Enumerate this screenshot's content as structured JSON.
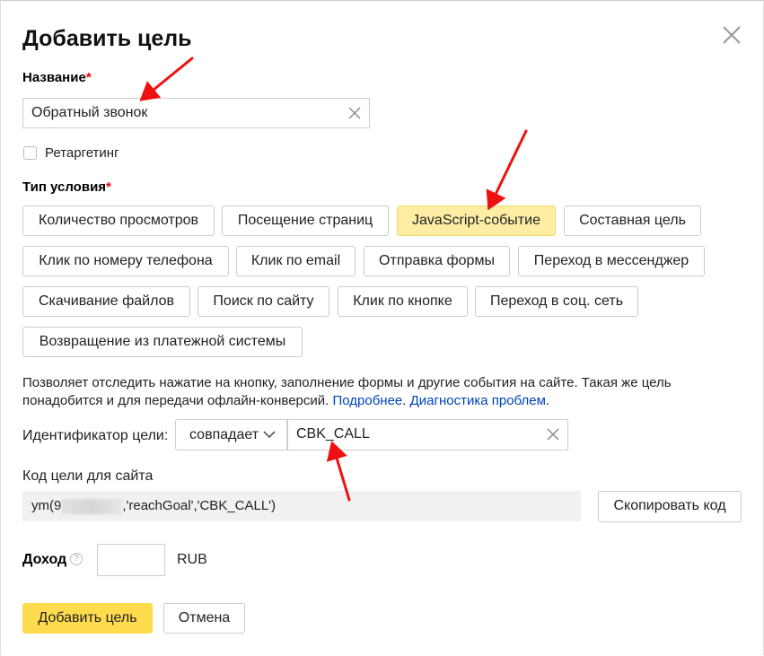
{
  "dialog": {
    "title": "Добавить цель",
    "name_label": "Название",
    "required_mark": "*",
    "name_value": "Обратный звонок",
    "retargeting_label": "Ретаргетинг",
    "retargeting_checked": false,
    "condition_label": "Тип условия",
    "condition_types": [
      "Количество просмотров",
      "Посещение страниц",
      "JavaScript-событие",
      "Составная цель",
      "Клик по номеру телефона",
      "Клик по email",
      "Отправка формы",
      "Переход в мессенджер",
      "Скачивание файлов",
      "Поиск по сайту",
      "Клик по кнопке",
      "Переход в соц. сеть",
      "Возвращение из платежной системы"
    ],
    "selected_condition": "JavaScript-событие",
    "description": "Позволяет отследить нажатие на кнопку, заполнение формы и другие события на сайте. Такая же цель понадобится и для передачи офлайн-конверсий.",
    "link_more": "Подробнее",
    "link_separator": ".",
    "link_diagnostics": "Диагностика проблем",
    "link_end": ".",
    "goal_id_label": "Идентификатор цели:",
    "match_select": "совпадает",
    "goal_id_value": "CBK_CALL",
    "code_label": "Код цели для сайта",
    "code_prefix": "ym(9",
    "code_suffix": ",'reachGoal','CBK_CALL')",
    "copy_button": "Скопировать код",
    "income_label": "Доход",
    "income_help": "?",
    "income_value": "",
    "currency": "RUB",
    "submit_button": "Добавить цель",
    "cancel_button": "Отмена"
  },
  "colors": {
    "accent_yellow": "#ffdb4d",
    "selected_bg": "#fdeea4",
    "link": "#0044bb",
    "required": "#ee0000",
    "annotation_arrow": "#ee1111"
  }
}
